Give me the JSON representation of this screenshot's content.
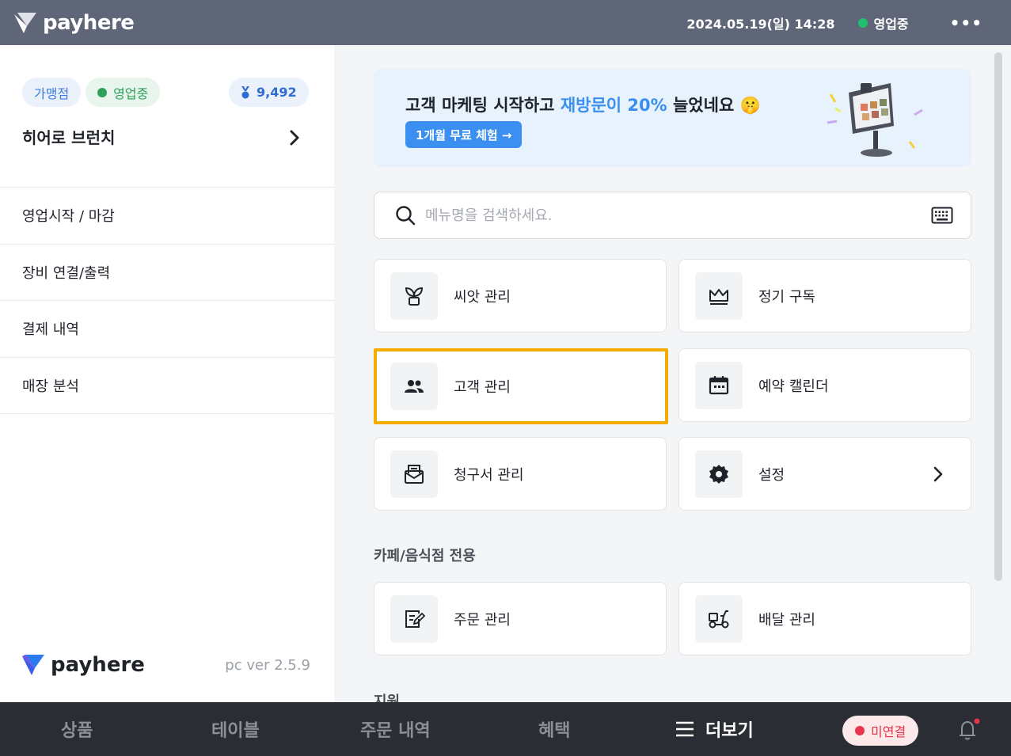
{
  "topbar": {
    "brand": "payhere",
    "datetime": "2024.05.19(일) 14:28",
    "status": "영업중",
    "more_icon": "more-dots-icon"
  },
  "sidebar": {
    "badge_type": "가맹점",
    "badge_status": "영업중",
    "points": "9,492",
    "store_name": "히어로 브런치",
    "menu": [
      {
        "label": "영업시작 / 마감"
      },
      {
        "label": "장비 연결/출력"
      },
      {
        "label": "결제 내역"
      },
      {
        "label": "매장 분석"
      }
    ],
    "footer_brand": "payhere",
    "version": "pc ver 2.5.9"
  },
  "banner": {
    "title_prefix": "고객 마케팅 시작하고 ",
    "title_highlight": "재방문이 20%",
    "title_suffix": " 늘었네요 🤫",
    "button": "1개월 무료 체험 →"
  },
  "search": {
    "placeholder": "메뉴명을 검색하세요."
  },
  "cards": {
    "seed": "씨앗 관리",
    "subscription": "정기 구독",
    "customer": "고객 관리",
    "reservation": "예약 캘린더",
    "invoice": "청구서 관리",
    "settings": "설정"
  },
  "section_cafe": {
    "title": "카페/음식점 전용",
    "order": "주문 관리",
    "delivery": "배달 관리"
  },
  "section_support": {
    "title": "지원"
  },
  "bottomnav": {
    "products": "상품",
    "tables": "테이블",
    "orders": "주문 내역",
    "benefits": "혜택",
    "more": "더보기",
    "connection": "미연결"
  },
  "colors": {
    "topbar": "#5f6677",
    "accent_blue": "#3b8ff0",
    "selected_border": "#f5ab00",
    "status_green": "#1fbf6f",
    "alert_red": "#e8344a"
  }
}
